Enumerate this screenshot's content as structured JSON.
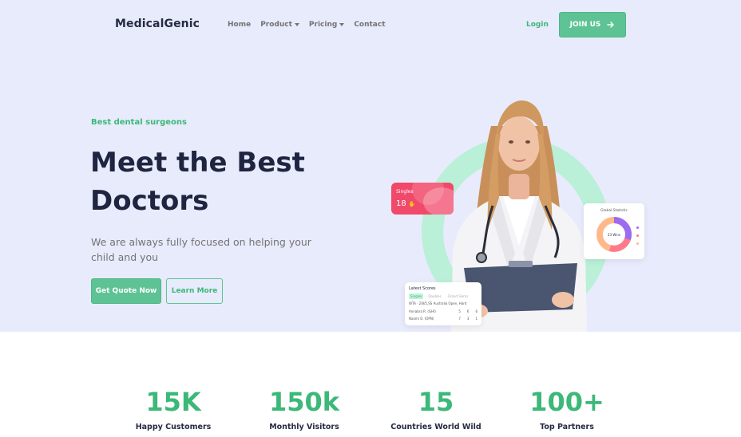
{
  "nav": {
    "logo": "MedicalGenic",
    "items": [
      {
        "label": "Home",
        "dropdown": false
      },
      {
        "label": "Product",
        "dropdown": true
      },
      {
        "label": "Pricing",
        "dropdown": true
      },
      {
        "label": "Contact",
        "dropdown": false
      }
    ],
    "login": "Login",
    "join": "JOIN US"
  },
  "hero": {
    "eyebrow": "Best dental surgeons",
    "headline_line1": "Meet the Best",
    "headline_line2": "Doctors",
    "subtitle": "We are always fully focused on helping your child and you",
    "primary_button": "Get Quote Now",
    "secondary_button": "Learn More"
  },
  "cards": {
    "singles": {
      "title": "Singles",
      "value": "18"
    },
    "global": {
      "title": "Global Statistic",
      "center": "23 Wins"
    },
    "scores": {
      "title": "Latest Scores",
      "tabs": [
        "Singles",
        "Doubles",
        "Grand Slams"
      ],
      "rows": [
        [
          "WTA · 2/8/5,SS Australia Open, Hard",
          "",
          "",
          ""
        ],
        [
          "Annabra R. (GHI)",
          "5",
          "6",
          "6"
        ],
        [
          "Naomi O. (OPN)",
          "7",
          "3",
          "1"
        ]
      ]
    }
  },
  "stats": [
    {
      "value": "15K",
      "label": "Happy Customers"
    },
    {
      "value": "150k",
      "label": "Monthly Visitors"
    },
    {
      "value": "15",
      "label": "Countries World Wild"
    },
    {
      "value": "100+",
      "label": "Top Partners"
    }
  ],
  "colors": {
    "accent": "#3cb878",
    "hero_bg": "#e8ebfc",
    "heading": "#252b42",
    "muted": "#737373",
    "card_red": "#f1496a"
  }
}
